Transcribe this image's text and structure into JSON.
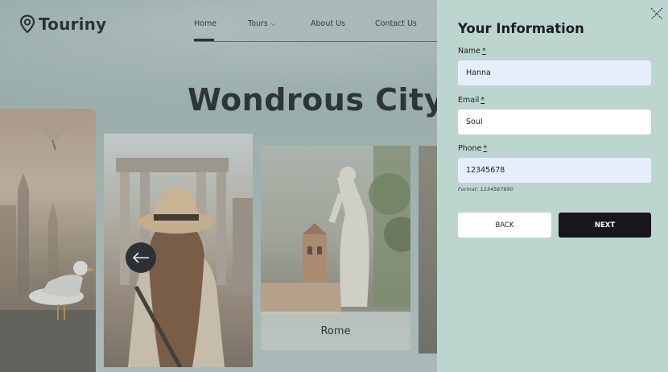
{
  "brand": {
    "name": "Touriny",
    "logo_icon": "map-pin-icon"
  },
  "nav": {
    "items": [
      {
        "label": "Home",
        "active": true
      },
      {
        "label": "Tours",
        "has_dropdown": true
      },
      {
        "label": "About Us"
      },
      {
        "label": "Contact Us"
      }
    ]
  },
  "hero": {
    "title": "Wondrous City To",
    "cards": [
      {
        "label": "Rome"
      }
    ],
    "prev_icon": "arrow-left-icon"
  },
  "panel": {
    "title": "Your Information",
    "close_icon": "close-icon",
    "fields": {
      "name": {
        "label": "Name",
        "required_mark": "*",
        "value": "Hanna"
      },
      "email": {
        "label": "Email",
        "required_mark": "*",
        "value": "Soul"
      },
      "phone": {
        "label": "Phone",
        "required_mark": "*",
        "value": "12345678",
        "hint": "Format: 1234567890"
      }
    },
    "back_label": "BACK",
    "next_label": "NEXT"
  },
  "colors": {
    "panel_bg": "#bdd5cf",
    "input_focus_bg": "#e7eefb",
    "next_button_bg": "#17161a"
  }
}
